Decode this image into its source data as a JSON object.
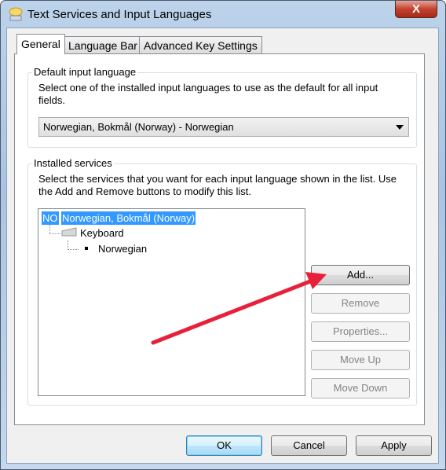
{
  "window": {
    "title": "Text Services and Input Languages",
    "close_label": "X"
  },
  "tabs": [
    {
      "label": "General",
      "active": true
    },
    {
      "label": "Language Bar"
    },
    {
      "label": "Advanced Key Settings"
    }
  ],
  "default_language": {
    "group_label": "Default input language",
    "description": "Select one of the installed input languages to use as the default for all input fields.",
    "selected": "Norwegian, Bokmål (Norway) - Norwegian"
  },
  "installed_services": {
    "group_label": "Installed services",
    "description": "Select the services that you want for each input language shown in the list. Use the Add and Remove buttons to modify this list.",
    "tree": {
      "code": "NO",
      "language": "Norwegian, Bokmål (Norway)",
      "category": "Keyboard",
      "service": "Norwegian"
    },
    "buttons": {
      "add": "Add...",
      "remove": "Remove",
      "properties": "Properties...",
      "move_up": "Move Up",
      "move_down": "Move Down"
    }
  },
  "footer": {
    "ok": "OK",
    "cancel": "Cancel",
    "apply": "Apply"
  },
  "annotation": {
    "arrow_color": "#e8203a"
  }
}
